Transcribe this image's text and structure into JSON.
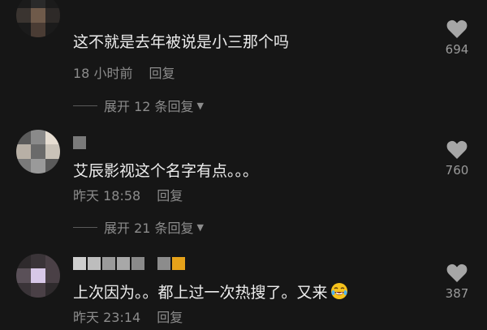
{
  "comments": [
    {
      "text": "这不就是去年被说是小三那个吗",
      "time": "18 小时前",
      "reply_label": "回复",
      "likes": "694",
      "expand_label": "展开 12 条回复"
    },
    {
      "text": "艾辰影视这个名字有点。。。",
      "time": "昨天 18:58",
      "reply_label": "回复",
      "likes": "760",
      "expand_label": "展开 21 条回复"
    },
    {
      "text": "上次因为。。都上过一次热搜了。又来",
      "time": "昨天 23:14",
      "reply_label": "回复",
      "likes": "387",
      "emoji": "rofl-face-icon"
    }
  ],
  "colors": {
    "background": "#161616",
    "text": "#ececec",
    "muted": "#8c8c8c",
    "heart": "#a6a6a6"
  }
}
